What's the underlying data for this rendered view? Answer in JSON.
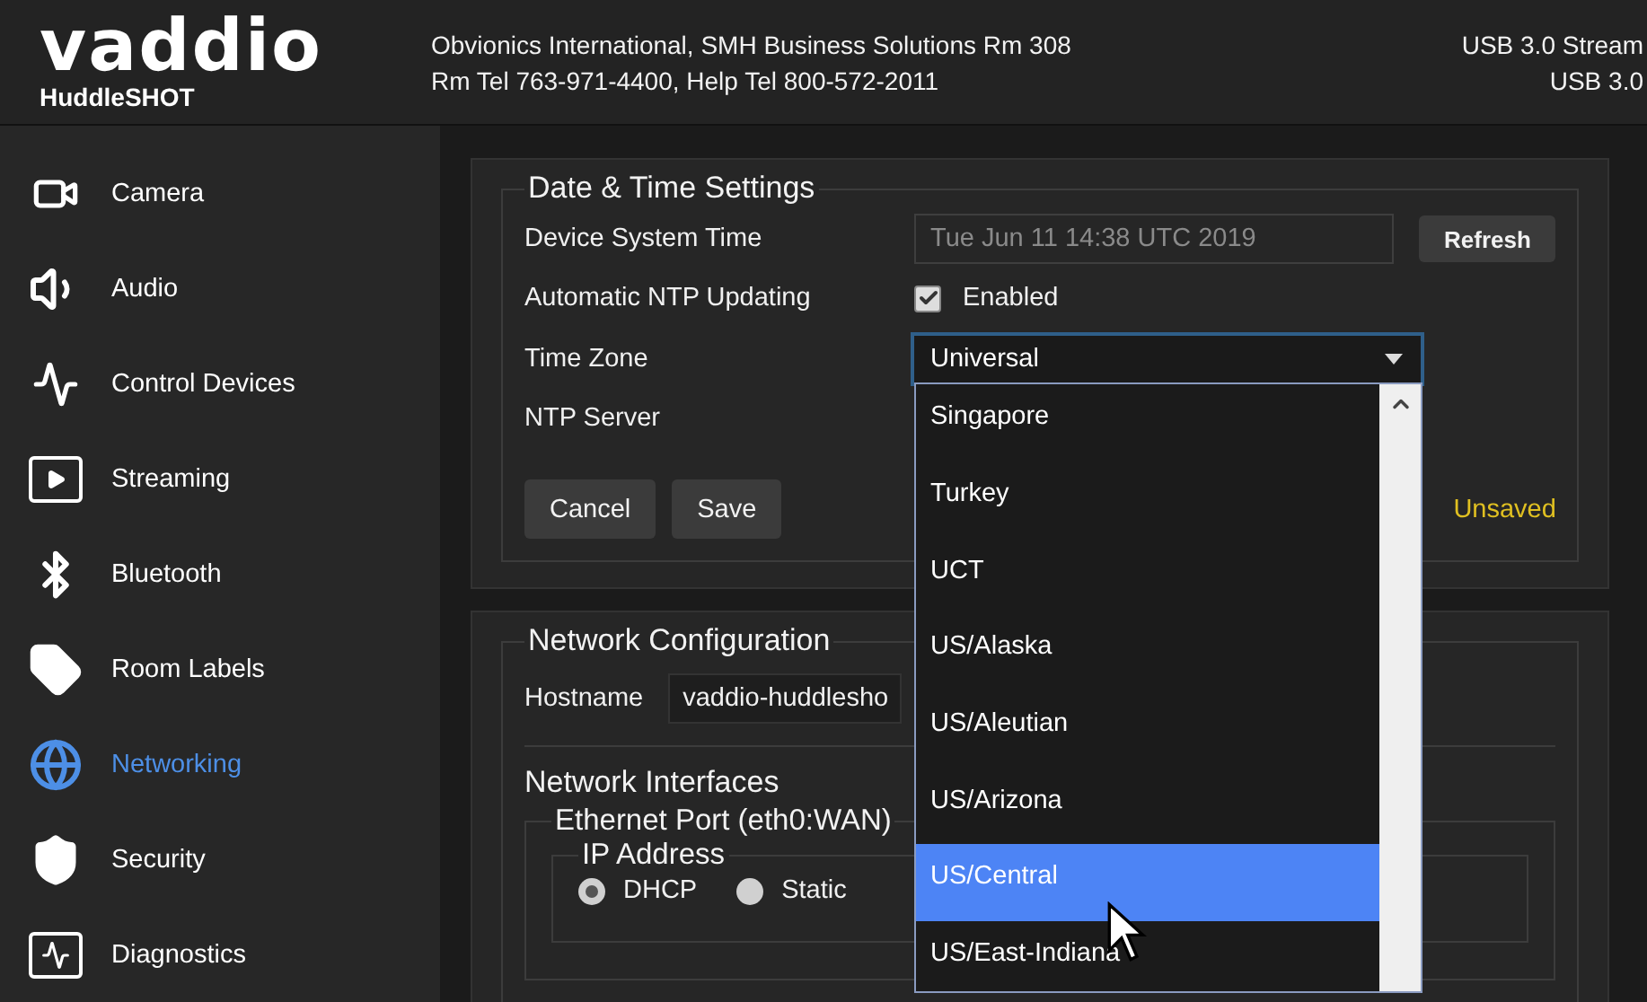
{
  "header": {
    "logo": "vaddio",
    "product": "HuddleSHOT",
    "line_1": "Obvionics International, SMH Business Solutions Rm 308",
    "line_2": "Rm Tel 763-971-4400, Help Tel 800-572-2011",
    "status_1": "USB 3.0 Stream",
    "status_2": "USB 3.0"
  },
  "sidebar": {
    "items": [
      {
        "label": "Camera",
        "selected": false
      },
      {
        "label": "Audio",
        "selected": false
      },
      {
        "label": "Control Devices",
        "selected": false
      },
      {
        "label": "Streaming",
        "selected": false
      },
      {
        "label": "Bluetooth",
        "selected": false
      },
      {
        "label": "Room Labels",
        "selected": false
      },
      {
        "label": "Networking",
        "selected": true
      },
      {
        "label": "Security",
        "selected": false
      },
      {
        "label": "Diagnostics",
        "selected": false
      }
    ]
  },
  "date_time": {
    "title": "Date & Time Settings",
    "device_time_label": "Device System Time",
    "device_time_value": "Tue Jun 11 14:38 UTC 2019",
    "refresh_button": "Refresh",
    "ntp_label": "Automatic NTP Updating",
    "ntp_checked": true,
    "ntp_option": "Enabled",
    "time_zone_label": "Time Zone",
    "time_zone_value": "Universal",
    "ntp_server_label": "NTP Server",
    "cancel_button": "Cancel",
    "save_button": "Save",
    "status": "Unsaved"
  },
  "time_zone_menu": {
    "options": [
      {
        "label": "Singapore",
        "selected": false
      },
      {
        "label": "Turkey",
        "selected": false
      },
      {
        "label": "UCT",
        "selected": false
      },
      {
        "label": "US/Alaska",
        "selected": false
      },
      {
        "label": "US/Aleutian",
        "selected": false
      },
      {
        "label": "US/Arizona",
        "selected": false
      },
      {
        "label": "US/Central",
        "selected": true
      },
      {
        "label": "US/East-Indiana",
        "selected": false
      }
    ]
  },
  "network": {
    "title": "Network Configuration",
    "hostname_label": "Hostname",
    "hostname_value": "vaddio-huddlesho",
    "interfaces_title": "Network Interfaces",
    "port_title": "Ethernet Port (eth0:WAN)",
    "ip_title": "IP Address",
    "ip_modes": [
      {
        "label": "DHCP",
        "selected": true
      },
      {
        "label": "Static",
        "selected": false
      }
    ]
  }
}
